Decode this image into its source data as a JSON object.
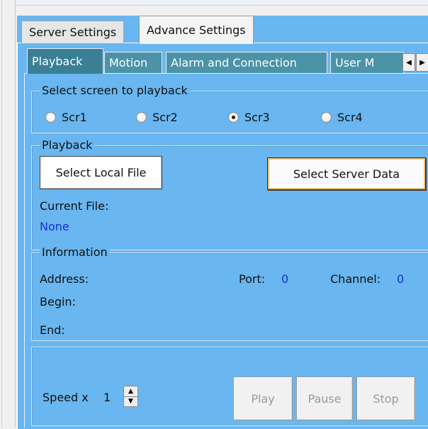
{
  "tabs": {
    "outer": [
      "Server Settings",
      "Advance Settings"
    ],
    "inner": [
      "Playback",
      "Motion",
      "Alarm and Connection",
      "User M"
    ]
  },
  "select_screen": {
    "title": "Select screen to playback",
    "options": [
      "Scr1",
      "Scr2",
      "Scr3",
      "Scr4"
    ],
    "selected": "Scr3"
  },
  "playback": {
    "title": "Playback",
    "select_local_file": "Select Local File",
    "select_server_data": "Select Server Data",
    "current_file_label": "Current File:",
    "current_file_value": "None"
  },
  "information": {
    "title": "Information",
    "address_label": "Address:",
    "port_label": "Port:",
    "port_value": "0",
    "channel_label": "Channel:",
    "channel_value": "0",
    "begin_label": "Begin:",
    "end_label": "End:"
  },
  "controls": {
    "speed_label": "Speed x",
    "speed_value": "1",
    "play": "Play",
    "pause": "Pause",
    "stop": "Stop"
  },
  "icons": {
    "scroll_left": "arrow-left-icon",
    "scroll_right": "arrow-right-icon",
    "spin_up": "chevron-up-icon",
    "spin_down": "chevron-down-icon"
  },
  "colors": {
    "panel": "#69b6f0",
    "active_tab": "#3b7f96",
    "value_text": "#1431d6"
  }
}
